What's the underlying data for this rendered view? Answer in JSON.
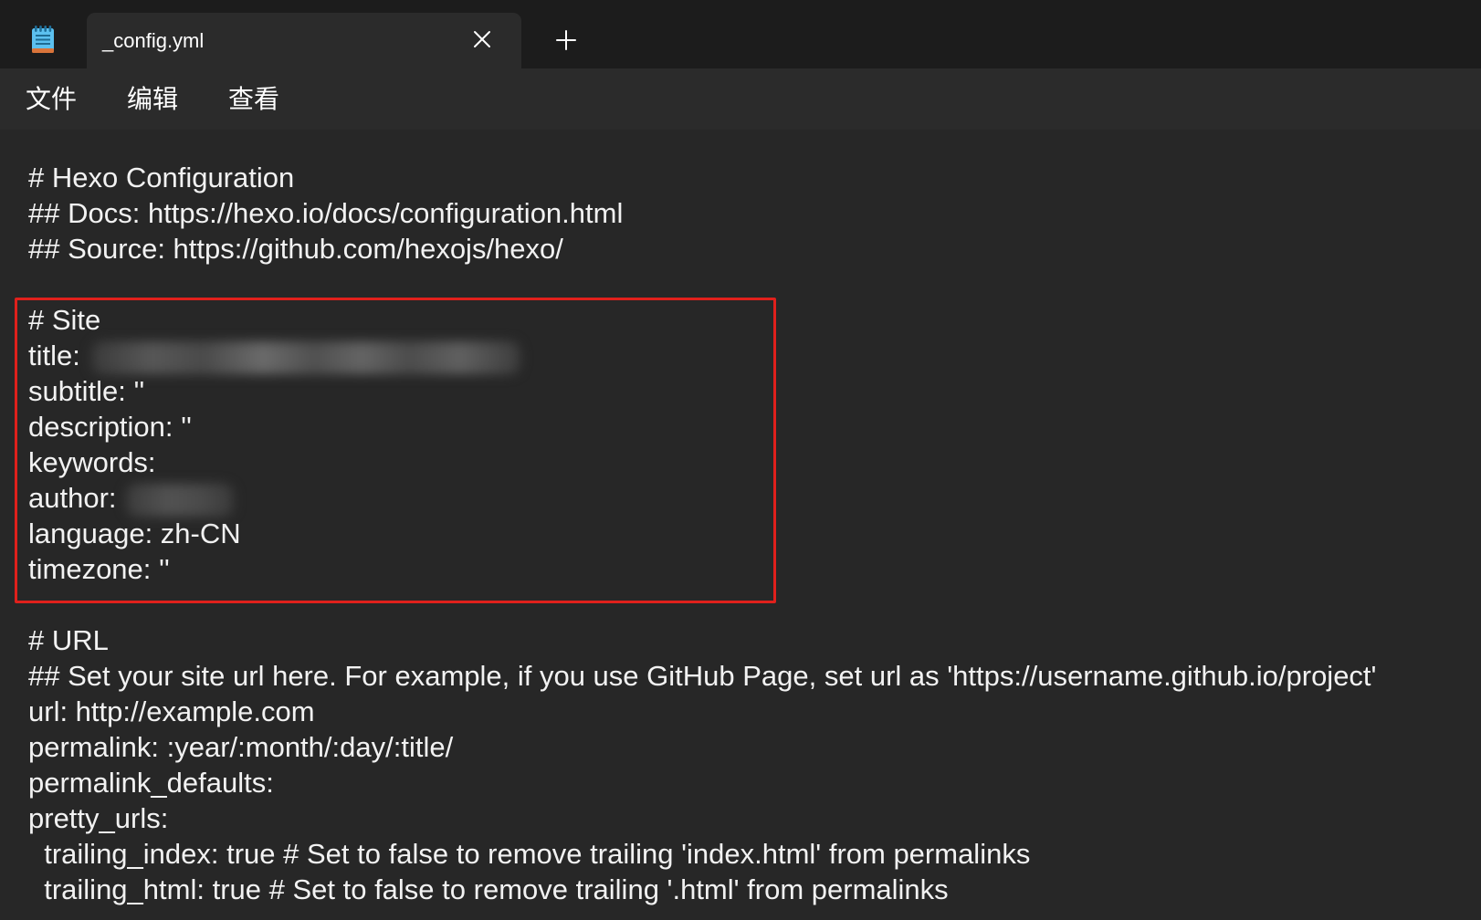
{
  "app": {
    "icon": "notepad-icon"
  },
  "tab": {
    "title": "_config.yml",
    "close_icon": "close-icon",
    "active": true
  },
  "new_tab": {
    "icon": "plus-icon"
  },
  "menu": {
    "items": [
      {
        "label": "文件"
      },
      {
        "label": "编辑"
      },
      {
        "label": "查看"
      }
    ]
  },
  "editor": {
    "lines": [
      {
        "text": "# Hexo Configuration"
      },
      {
        "text": "## Docs: https://hexo.io/docs/configuration.html"
      },
      {
        "text": "## Source: https://github.com/hexojs/hexo/"
      },
      {
        "text": ""
      },
      {
        "text": "# Site"
      },
      {
        "text": "title:",
        "blurred_value": true
      },
      {
        "text": "subtitle: ''"
      },
      {
        "text": "description: ''"
      },
      {
        "text": "keywords:"
      },
      {
        "text": "author:",
        "blurred_value": true
      },
      {
        "text": "language: zh-CN"
      },
      {
        "text": "timezone: ''"
      },
      {
        "text": ""
      },
      {
        "text": "# URL"
      },
      {
        "text": "## Set your site url here. For example, if you use GitHub Page, set url as 'https://username.github.io/project'"
      },
      {
        "text": "url: http://example.com"
      },
      {
        "text": "permalink: :year/:month/:day/:title/"
      },
      {
        "text": "permalink_defaults:"
      },
      {
        "text": "pretty_urls:"
      },
      {
        "text": "  trailing_index: true # Set to false to remove trailing 'index.html' from permalinks"
      },
      {
        "text": "  trailing_html: true # Set to false to remove trailing '.html' from permalinks"
      }
    ]
  },
  "highlight_box": {
    "color": "#e0201c"
  },
  "colors": {
    "titlebar": "#1c1c1c",
    "tab": "#2b2b2b",
    "menubar": "#2b2b2b",
    "editor": "#272727",
    "text": "#f2f2f2",
    "highlight": "#e0201c"
  }
}
